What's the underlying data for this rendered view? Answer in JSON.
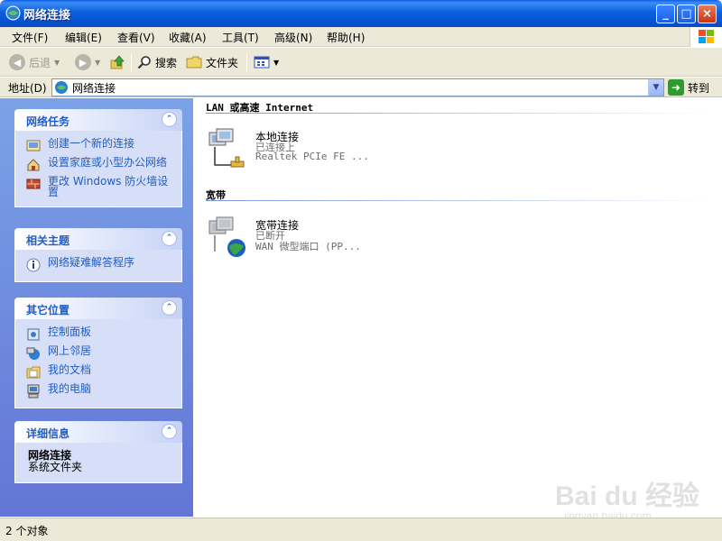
{
  "window": {
    "title": "网络连接",
    "minimize": "_",
    "maximize": "□",
    "close": "×"
  },
  "menu": [
    "文件(F)",
    "编辑(E)",
    "查看(V)",
    "收藏(A)",
    "工具(T)",
    "高级(N)",
    "帮助(H)"
  ],
  "toolbar": {
    "back": "后退",
    "search": "搜索",
    "folders": "文件夹"
  },
  "address": {
    "label": "地址(D)",
    "value": "网络连接",
    "go": "转到"
  },
  "taskpane": {
    "network_tasks": {
      "title": "网络任务",
      "items": [
        {
          "label": "创建一个新的连接",
          "icon": "new-connection-icon"
        },
        {
          "label": "设置家庭或小型办公网络",
          "icon": "home-network-icon"
        },
        {
          "label": "更改 Windows 防火墙设置",
          "icon": "firewall-icon"
        }
      ]
    },
    "related": {
      "title": "相关主题",
      "items": [
        {
          "label": "网络疑难解答程序",
          "icon": "info-icon"
        }
      ]
    },
    "other_places": {
      "title": "其它位置",
      "items": [
        {
          "label": "控制面板",
          "icon": "control-panel-icon"
        },
        {
          "label": "网上邻居",
          "icon": "network-places-icon"
        },
        {
          "label": "我的文档",
          "icon": "my-documents-icon"
        },
        {
          "label": "我的电脑",
          "icon": "my-computer-icon"
        }
      ]
    },
    "details": {
      "title": "详细信息",
      "name": "网络连接",
      "type": "系统文件夹"
    }
  },
  "content": {
    "groups": [
      {
        "heading": "LAN 或高速 Internet",
        "connections": [
          {
            "name": "本地连接",
            "status": "已连接上",
            "device": "Realtek PCIe FE ..."
          }
        ]
      },
      {
        "heading": "宽带",
        "connections": [
          {
            "name": "宽带连接",
            "status": "已断开",
            "device": "WAN 微型端口 (PP..."
          }
        ]
      }
    ]
  },
  "statusbar": {
    "text": "2 个对象"
  },
  "watermark": {
    "text": "Bai du 经验",
    "url": "jingyan.baidu.com"
  },
  "colors": {
    "title_bar": "#0a5fde",
    "task_pane": "#6d8be0",
    "link": "#215dc6"
  }
}
